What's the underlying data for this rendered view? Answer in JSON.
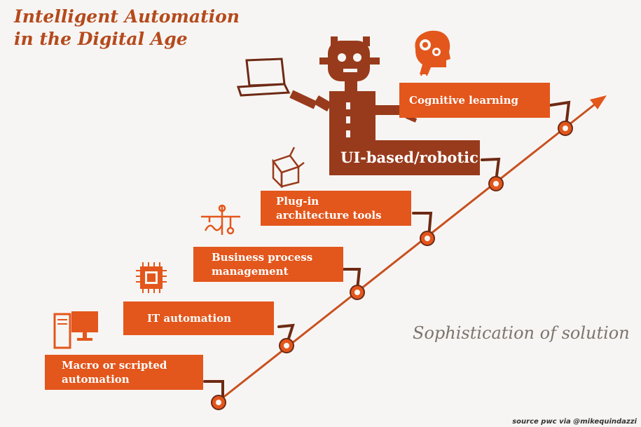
{
  "title": {
    "line1": "Intelligent Automation",
    "line2": "in the Digital Age"
  },
  "steps": [
    {
      "id": "macro",
      "line1": "Macro or scripted",
      "line2": "automation"
    },
    {
      "id": "it",
      "line1": "IT automation"
    },
    {
      "id": "bpm",
      "line1": "Business process",
      "line2": "management"
    },
    {
      "id": "plugin",
      "line1": "Plug-in",
      "line2": "architecture tools"
    },
    {
      "id": "ui",
      "line1": "UI-based/robotic"
    },
    {
      "id": "cognitive",
      "line1": "Cognitive learning"
    }
  ],
  "axis_label": "Sophistication of solution",
  "source": "source pwc via @mikequindazzi",
  "colors": {
    "orange": "#e3561c",
    "brown": "#983b1c",
    "title": "#b54a1c",
    "background": "#f7f5f3"
  },
  "icons": [
    "desktop-computer-icon",
    "microchip-icon",
    "circuit-icon",
    "cube-icon",
    "robot-icon",
    "laptop-icon",
    "brain-gears-icon"
  ]
}
